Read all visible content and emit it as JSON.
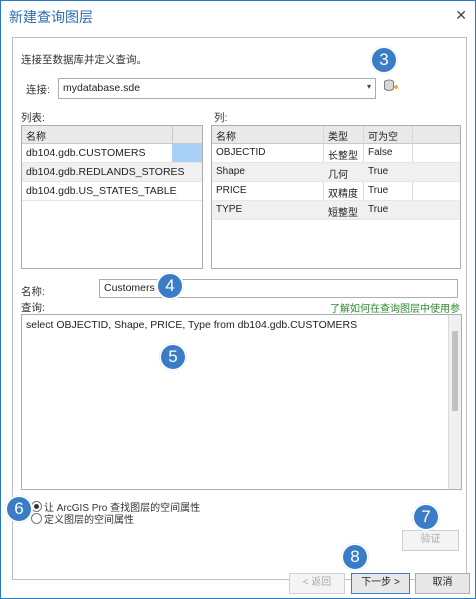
{
  "window": {
    "title": "新建查询图层",
    "close_glyph": "✕"
  },
  "intro": "连接至数据库并定义查询。",
  "connection": {
    "label": "连接:",
    "value": "mydatabase.sde"
  },
  "tables": {
    "label": "列表:",
    "header": "名称",
    "items": [
      "db104.gdb.CUSTOMERS",
      "db104.gdb.REDLANDS_STORES",
      "db104.gdb.US_STATES_TABLE"
    ]
  },
  "columns": {
    "label": "列:",
    "headers": [
      "名称",
      "类型",
      "可为空"
    ],
    "rows": [
      [
        "OBJECTID",
        "长整型",
        "False"
      ],
      [
        "Shape",
        "几何",
        "True"
      ],
      [
        "PRICE",
        "双精度",
        "True"
      ],
      [
        "TYPE",
        "短整型",
        "True"
      ]
    ]
  },
  "name_field": {
    "label": "名称:",
    "value": "Customers"
  },
  "query": {
    "label": "查询:",
    "help_link": "了解如何在查询图层中使用参数",
    "text": "select OBJECTID, Shape, PRICE, Type from db104.gdb.CUSTOMERS"
  },
  "spatial_options": [
    "让 ArcGIS Pro 查找图层的空间属性",
    "定义图层的空间属性"
  ],
  "buttons": {
    "validate": "验证",
    "back": "< 返回",
    "next": "下一步 >",
    "cancel": "取消"
  },
  "callouts": [
    "3",
    "4",
    "5",
    "6",
    "7",
    "8"
  ],
  "colors": {
    "accent": "#3a7cc6",
    "link": "#2e8b2e",
    "selection": "#cce4f7"
  }
}
